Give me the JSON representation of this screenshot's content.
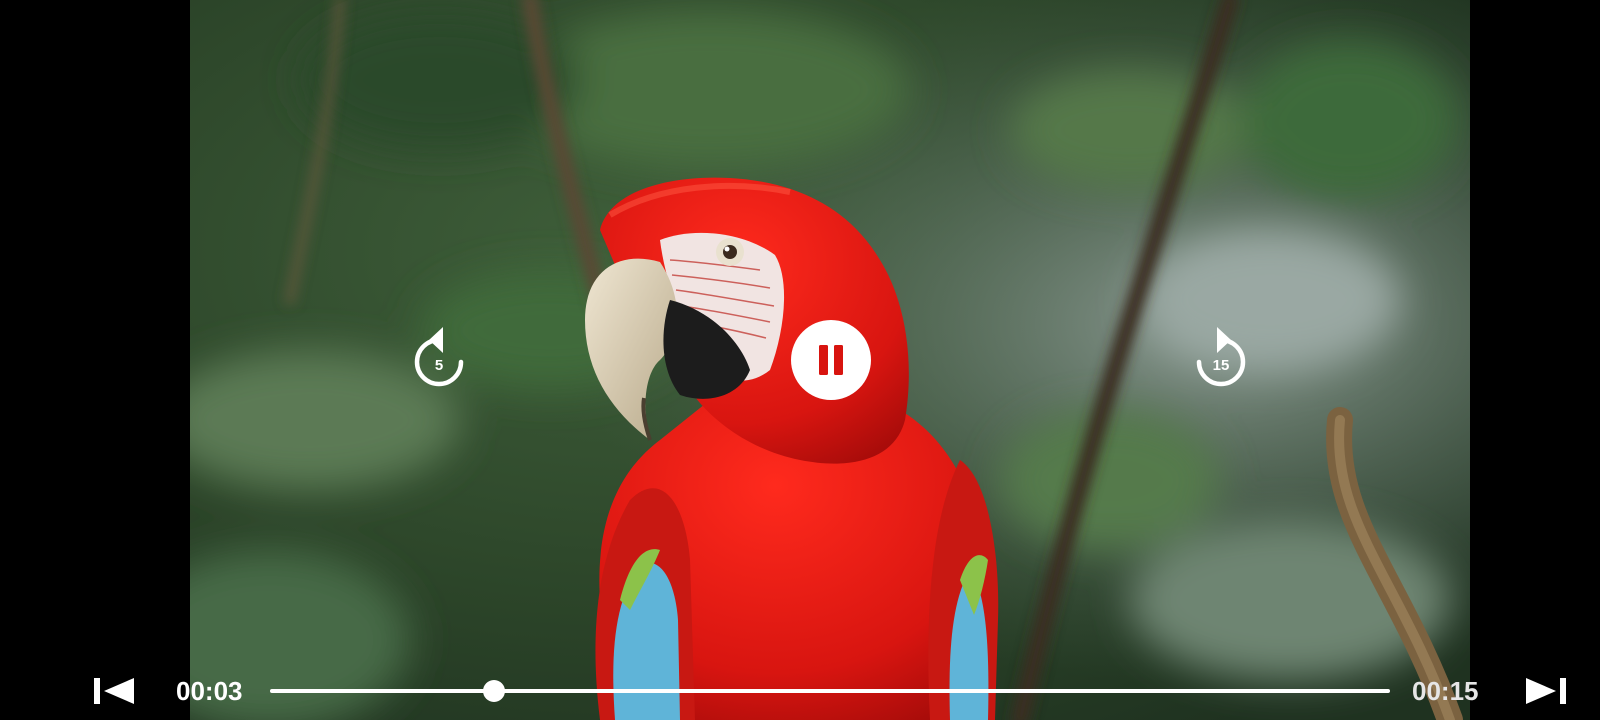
{
  "player": {
    "current_time": "00:03",
    "total_time": "00:15",
    "progress_fraction": 0.2
  },
  "controls": {
    "rewind_seconds": "5",
    "forward_seconds": "15",
    "state": "playing"
  },
  "icons": {
    "rewind": "rewind-5-icon",
    "forward": "forward-15-icon",
    "pause": "pause-icon",
    "previous": "skip-previous-icon",
    "next": "skip-next-icon"
  },
  "colors": {
    "controls": "#ffffff",
    "letterbox": "#000000"
  }
}
